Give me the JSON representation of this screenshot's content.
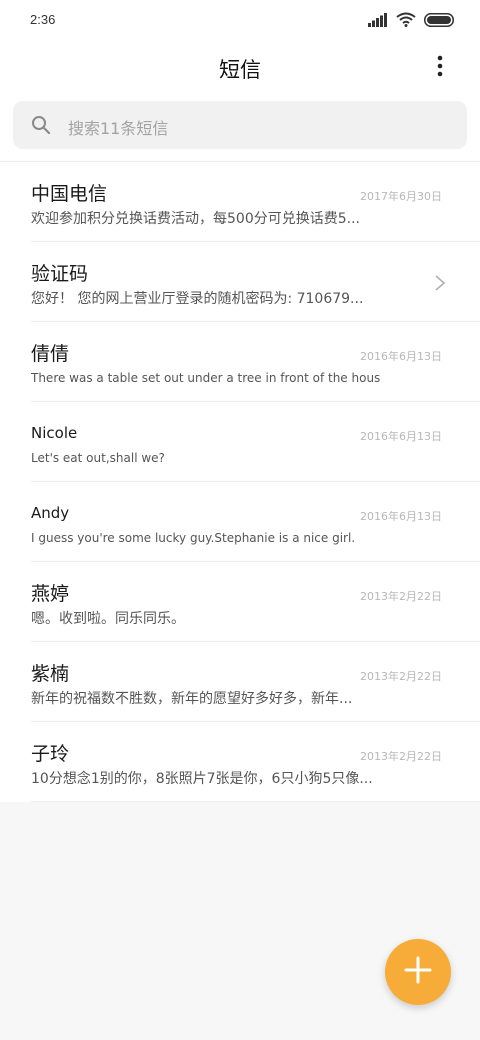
{
  "status_bar": {
    "time": "2:36"
  },
  "header": {
    "title": "短信",
    "more_icon": "more-vertical-icon"
  },
  "search": {
    "placeholder": "搜索11条短信",
    "icon": "search-icon"
  },
  "messages": [
    {
      "name": "中国电信",
      "date": "2017年6月30日",
      "preview": "欢迎参加积分兑换话费活动，每500分可兑换话费5..."
    },
    {
      "name": "验证码",
      "date": "",
      "preview": "您好！ 您的网上营业厅登录的随机密码为: 710679..."
    },
    {
      "name": "倩倩",
      "date": "2016年6月13日",
      "preview": "There was a table set out under a tree in front of the hous"
    },
    {
      "name": "Nicole",
      "date": "2016年6月13日",
      "preview": "Let's eat out,shall we?"
    },
    {
      "name": "Andy",
      "date": "2016年6月13日",
      "preview": "I guess you're some lucky guy.Stephanie is a nice girl."
    },
    {
      "name": "燕婷",
      "date": "2013年2月22日",
      "preview": "嗯。收到啦。同乐同乐。"
    },
    {
      "name": "紫楠",
      "date": "2013年2月22日",
      "preview": "新年的祝福数不胜数，新年的愿望好多好多，新年..."
    },
    {
      "name": "子玲",
      "date": "2013年2月22日",
      "preview": "10分想念1别的你，8张照片7张是你，6只小狗5只像..."
    }
  ],
  "fab": {
    "icon": "plus-icon",
    "color": "#f7ac3a"
  },
  "colors": {
    "accent": "#f7ac3a",
    "background": "#f7f7f7"
  }
}
